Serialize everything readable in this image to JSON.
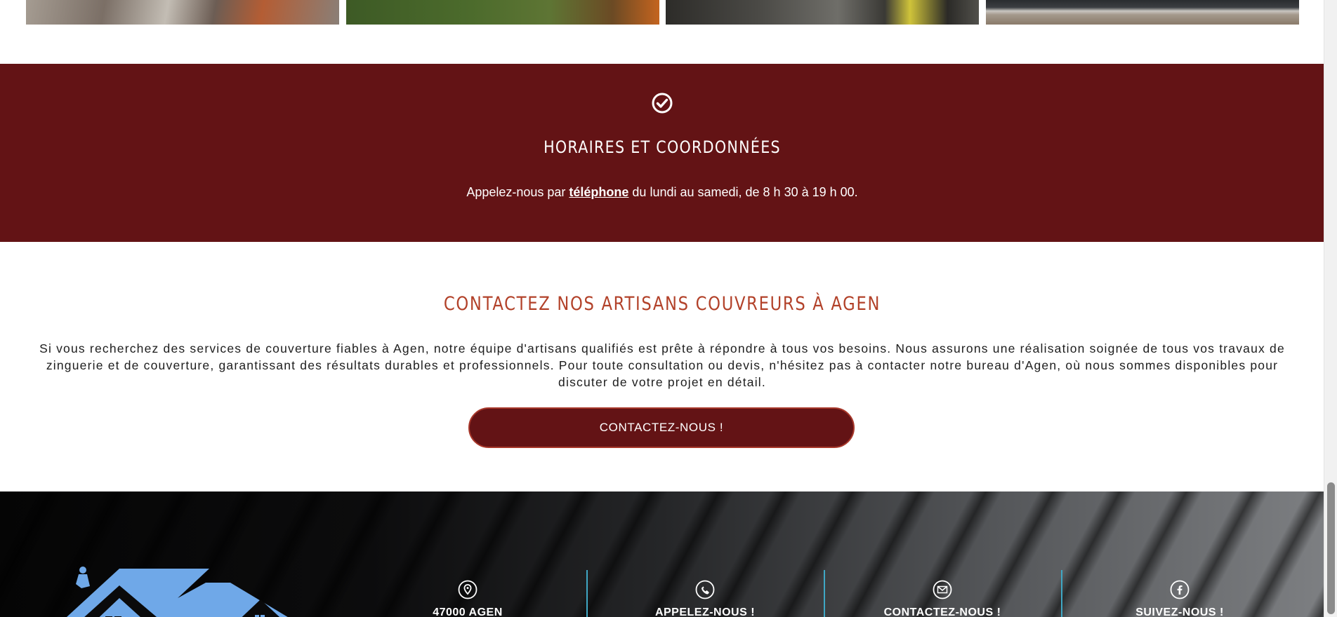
{
  "gallery": {
    "images": [
      {
        "alt": "roof-tiles-photo"
      },
      {
        "alt": "garden-photo"
      },
      {
        "alt": "roof-repair-photo"
      },
      {
        "alt": "gutter-photo"
      }
    ]
  },
  "hours_band": {
    "icon": "check-circle-icon",
    "title": "HORAIRES ET COORDONNÉES",
    "text_before": "Appelez-nous par ",
    "link_text": "téléphone",
    "text_after": " du lundi au samedi, de 8 h 30 à 19 h 00.",
    "background": "#631315"
  },
  "contact": {
    "title": "CONTACTEZ NOS ARTISANS COUVREURS À AGEN",
    "paragraph": "Si vous recherchez des services de couverture fiables à Agen, notre équipe d'artisans qualifiés est prête à répondre à tous vos besoins. Nous assurons une réalisation soignée de tous vos travaux de zinguerie et de couverture, garantissant des résultats durables et professionnels. Pour toute consultation ou devis, n'hésitez pas à contacter notre bureau d'Agen, où nous sommes disponibles pour discuter de votre projet en détail.",
    "button_label": "CONTACTEZ-NOUS !",
    "title_color": "#b24129"
  },
  "footer": {
    "columns": [
      {
        "icon": "location-pin-icon",
        "label": "47000 AGEN"
      },
      {
        "icon": "phone-icon",
        "label": "APPELEZ-NOUS !"
      },
      {
        "icon": "envelope-icon",
        "label": "CONTACTEZ-NOUS !"
      },
      {
        "icon": "facebook-icon",
        "label": "SUIVEZ-NOUS !"
      }
    ],
    "divider_color": "#3fa7c4",
    "logo_color": "#6fa8e8"
  }
}
